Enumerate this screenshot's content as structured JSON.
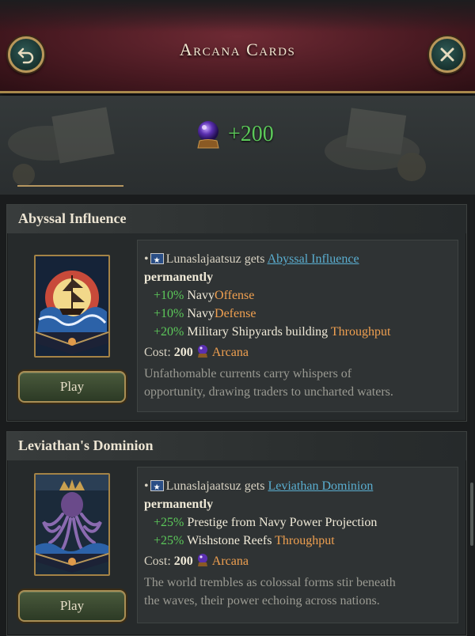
{
  "header": {
    "title": "Arcana Cards",
    "back_icon": "back-arrow-icon",
    "close_icon": "close-icon"
  },
  "banner": {
    "gain": "+200",
    "icon": "crystal-ball-icon"
  },
  "cards": [
    {
      "title": "Abyssal Influence",
      "country": "Lunaslajaatsuz",
      "gets": "gets",
      "effect_link": "Abyssal Influence",
      "duration": "permanently",
      "modifiers": [
        {
          "value": "+10%",
          "label": "Navy",
          "accent": "Offense"
        },
        {
          "value": "+10%",
          "label": "Navy",
          "accent": "Defense"
        },
        {
          "value": "+20%",
          "label": "Military Shipyards building",
          "accent": "Throughput"
        }
      ],
      "cost_label": "Cost:",
      "cost_value": "200",
      "cost_currency": "Arcana",
      "flavor_1": "Unfathomable currents carry whispers of",
      "flavor_2": "opportunity, drawing traders to uncharted waters.",
      "play_label": "Play",
      "art_icon": "ship-card-icon"
    },
    {
      "title": "Leviathan's Dominion",
      "country": "Lunaslajaatsuz",
      "gets": "gets",
      "effect_link": "Leviathan Dominion",
      "duration": "permanently",
      "modifiers": [
        {
          "value": "+25%",
          "label": "Prestige from Navy Power Projection",
          "accent": ""
        },
        {
          "value": "+25%",
          "label": "Wishstone Reefs",
          "accent": "Throughput"
        }
      ],
      "cost_label": "Cost:",
      "cost_value": "200",
      "cost_currency": "Arcana",
      "flavor_1": "The world trembles as colossal forms stir beneath",
      "flavor_2": "the waves, their power echoing across nations.",
      "play_label": "Play",
      "art_icon": "kraken-card-icon"
    }
  ],
  "colors": {
    "positive": "#5cc95a",
    "accent": "#f0a050",
    "link": "#5aaed0",
    "frame_gold": "#b8975a",
    "header_red": "#5a1f28"
  }
}
